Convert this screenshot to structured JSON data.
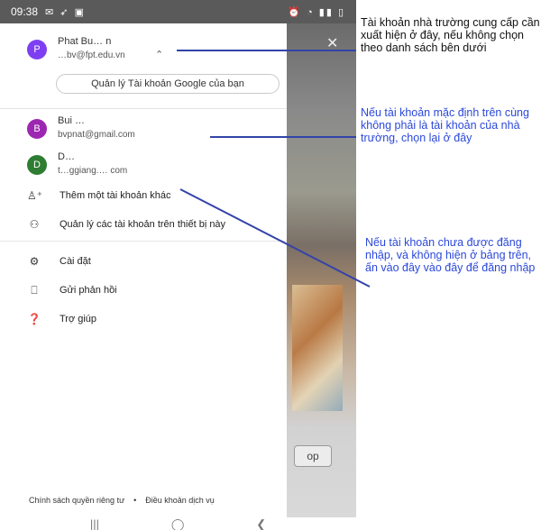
{
  "status_bar": {
    "time": "09:38"
  },
  "accounts": [
    {
      "initial": "P",
      "name": "Phat Bu… n",
      "email": "…bv@fpt.edu.vn",
      "color": "#7e3ff2"
    },
    {
      "initial": "B",
      "name": "Bui …",
      "email": "bvpnat@gmail.com",
      "color": "#9c27b0"
    },
    {
      "initial": "D",
      "name": "D…",
      "email": "t…ggiang.… com",
      "color": "#2e7d32"
    }
  ],
  "manage_google_account": "Quản lý Tài khoản Google của bạn",
  "menu": {
    "add_account": "Thêm một tài khoản khác",
    "manage_device_accounts": "Quản lý các tài khoản trên thiết bị này",
    "settings": "Cài đặt",
    "feedback": "Gửi phản hồi",
    "help": "Trợ giúp"
  },
  "footer": {
    "privacy": "Chính sách quyền riêng tư",
    "separator": "•",
    "terms": "Điều khoản dịch vụ"
  },
  "backdrop_button": "op",
  "annotations": {
    "note1": "Tài khoản nhà trường cung cấp cần xuất hiện ở đây, nếu không chọn theo danh sách bên dưới",
    "note2": "Nếu tài khoản mặc định trên cùng không phải là tài khoản của nhà trường, chọn lại ở đây",
    "note3": "Nếu tài khoản chưa được đăng nhập, và không hiện ở bảng trên, ấn vào đây vào đây để đăng nhập"
  },
  "colors": {
    "annotation_blue": "#2b48d9",
    "line_blue": "#3344a8"
  }
}
